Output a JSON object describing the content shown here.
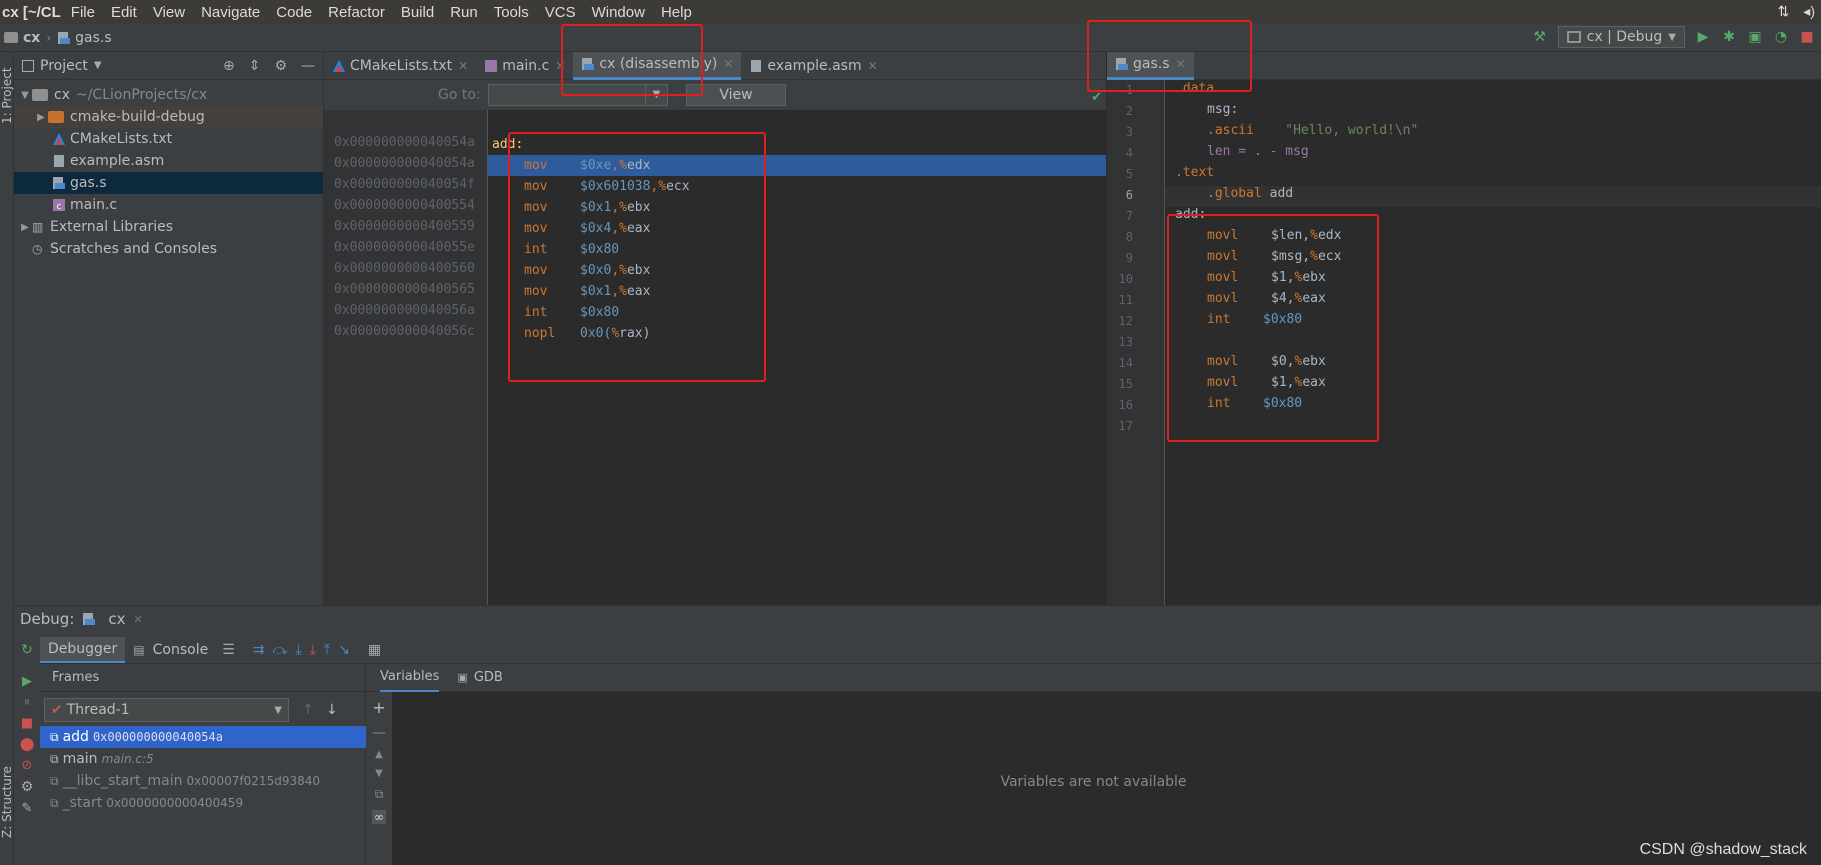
{
  "window": {
    "title": "cx [~/CL",
    "menu": [
      "File",
      "Edit",
      "View",
      "Navigate",
      "Code",
      "Refactor",
      "Build",
      "Run",
      "Tools",
      "VCS",
      "Window",
      "Help"
    ]
  },
  "navbar": {
    "project": "cx",
    "file": "gas.s",
    "run_config": "cx | Debug"
  },
  "side_labels": {
    "project": "1: Project",
    "structure": "Z: Structure"
  },
  "project_panel": {
    "title": "Project",
    "root_name": "cx",
    "root_path": "~/CLionProjects/cx",
    "items": [
      {
        "label": "cmake-build-debug"
      },
      {
        "label": "CMakeLists.txt"
      },
      {
        "label": "example.asm"
      },
      {
        "label": "gas.s"
      },
      {
        "label": "main.c"
      }
    ],
    "external": "External Libraries",
    "scratches": "Scratches and Consoles"
  },
  "left_tabs": [
    "CMakeLists.txt",
    "main.c",
    "cx (disassembly)",
    "example.asm"
  ],
  "goto": {
    "label": "Go to:",
    "view_button": "View"
  },
  "disassembly": {
    "addresses": [
      "0x000000000040054a",
      "0x000000000040054a",
      "0x000000000040054f",
      "0x0000000000400554",
      "0x0000000000400559",
      "0x000000000040055e",
      "0x0000000000400560",
      "0x0000000000400565",
      "0x000000000040056a",
      "0x000000000040056c"
    ],
    "label": "add:",
    "lines": [
      {
        "op": "mov",
        "arg": "$0xe",
        "reg": "edx"
      },
      {
        "op": "mov",
        "arg": "$0x601038",
        "reg": "ecx"
      },
      {
        "op": "mov",
        "arg": "$0x1",
        "reg": "ebx"
      },
      {
        "op": "mov",
        "arg": "$0x4",
        "reg": "eax"
      },
      {
        "op": "int",
        "arg": "$0x80",
        "reg": ""
      },
      {
        "op": "mov",
        "arg": "$0x0",
        "reg": "ebx"
      },
      {
        "op": "mov",
        "arg": "$0x1",
        "reg": "eax"
      },
      {
        "op": "int",
        "arg": "$0x80",
        "reg": ""
      },
      {
        "op": "nopl",
        "arg": "0x0(",
        "reg": "rax"
      }
    ]
  },
  "right_tab": "gas.s",
  "gas_source": {
    "line_numbers": [
      "1",
      "2",
      "3",
      "4",
      "5",
      "6",
      "7",
      "8",
      "9",
      "10",
      "11",
      "12",
      "13",
      "14",
      "15",
      "16",
      "17"
    ],
    "l1": ".data",
    "l2": "msg:",
    "l3_dir": ".ascii",
    "l3_str": "\"Hello, world!\\n\"",
    "l4": "len = . - msg",
    "l5": ".text",
    "l6_dir": ".global",
    "l6_name": "add",
    "l7": "add:",
    "l8": [
      "movl",
      "$len,",
      "edx"
    ],
    "l9": [
      "movl",
      "$msg,",
      "ecx"
    ],
    "l10": [
      "movl",
      "$1,",
      "ebx"
    ],
    "l11": [
      "movl",
      "$4,",
      "eax"
    ],
    "l12": [
      "int",
      "$0x80"
    ],
    "l14": [
      "movl",
      "$0,",
      "ebx"
    ],
    "l15": [
      "movl",
      "$1,",
      "eax"
    ],
    "l16": [
      "int",
      "$0x80"
    ]
  },
  "debug": {
    "title": "Debug:",
    "session": "cx",
    "tabs": [
      "Debugger",
      "Console"
    ],
    "frames_title": "Frames",
    "thread": "Thread-1",
    "frames": [
      {
        "name": "add",
        "detail": "0x000000000040054a"
      },
      {
        "name": "main",
        "detail": "main.c:5"
      },
      {
        "name": "__libc_start_main",
        "detail": "0x00007f0215d93840"
      },
      {
        "name": "_start",
        "detail": "0x0000000000400459"
      }
    ],
    "var_tabs": [
      "Variables",
      "GDB"
    ],
    "empty_vars": "Variables are not available"
  },
  "watermark": "CSDN @shadow_stack",
  "colors": {
    "accent": "#4a88c7",
    "selection": "#2f65ca",
    "annotation": "#e02020"
  }
}
